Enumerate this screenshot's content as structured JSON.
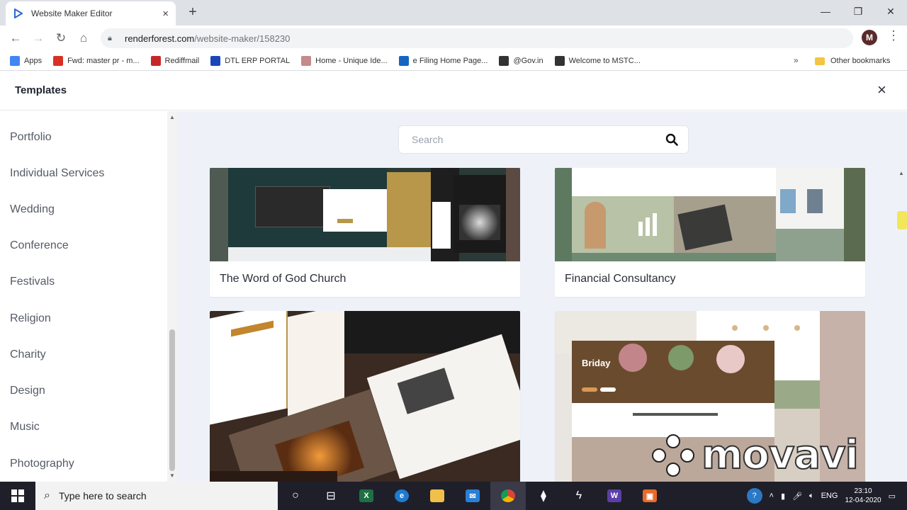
{
  "browser": {
    "tab_title": "Website Maker Editor",
    "tab_close": "×",
    "new_tab": "+",
    "url_host": "renderforest.com",
    "url_path": "/website-maker/158230",
    "avatar_letter": "M",
    "bookmarks": [
      {
        "label": "Apps",
        "icon": "apps-grid-icon",
        "color": "#4285f4"
      },
      {
        "label": "Fwd: master pr - m...",
        "icon": "gmail-icon",
        "color": "#d93025"
      },
      {
        "label": "Rediffmail",
        "icon": "rediff-icon",
        "color": "#c62828"
      },
      {
        "label": "DTL ERP PORTAL",
        "icon": "dtl-icon",
        "color": "#1a47b8"
      },
      {
        "label": "Home - Unique Ide...",
        "icon": "home-site-icon",
        "color": "#c58a8a"
      },
      {
        "label": "e Filing Home Page...",
        "icon": "efiling-icon",
        "color": "#1565c0"
      },
      {
        "label": "@Gov.in",
        "icon": "globe-icon",
        "color": "#333333"
      },
      {
        "label": "Welcome to MSTC...",
        "icon": "globe-icon",
        "color": "#333333"
      }
    ],
    "more_bookmarks": "»",
    "other_bookmarks": "Other bookmarks"
  },
  "app": {
    "title": "Templates",
    "close": "×",
    "search_placeholder": "Search",
    "categories": [
      "Portfolio",
      "Individual Services",
      "Wedding",
      "Conference",
      "Festivals",
      "Religion",
      "Charity",
      "Design",
      "Music",
      "Photography"
    ],
    "cards": [
      {
        "caption": "The Word of God Church"
      },
      {
        "caption": "Financial Consultancy"
      },
      {
        "caption": ""
      },
      {
        "caption": ""
      }
    ],
    "bridal_brand": "Briday"
  },
  "watermark": "movavi",
  "taskbar": {
    "search_placeholder": "Type here to search",
    "lang": "ENG",
    "time": "23:10",
    "date": "12-04-2020"
  },
  "colors": {
    "accent_gold": "#b8964a",
    "church_dark": "#1f3a3a",
    "sage": "#7f9a83"
  }
}
